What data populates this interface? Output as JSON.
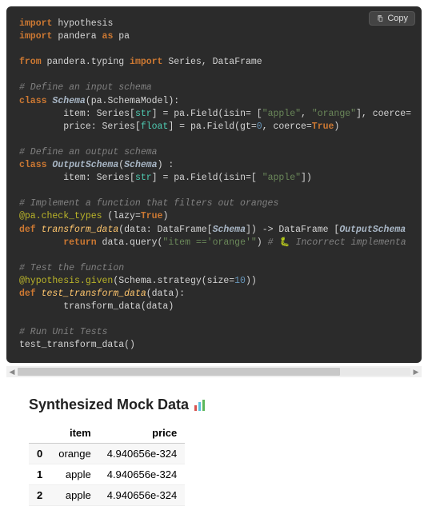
{
  "copy_label": "Copy",
  "code": {
    "l01_import": "import",
    "l01_hypothesis": "hypothesis",
    "l02_import": "import",
    "l02_pandera": "pandera",
    "l02_as": "as",
    "l02_pa": "pa",
    "l04_from": "from",
    "l04_mod": "pandera.typing",
    "l04_import": "import",
    "l04_items": "Series, DataFrame",
    "c1": "# Define an input schema",
    "l06_class": "class",
    "l06_name": "Schema",
    "l06_base": "(pa.SchemaModel):",
    "l07": "        item: Series[",
    "l07_type": "str",
    "l07_b": "] = pa.Field(isin= [",
    "l07_s1": "\"apple\"",
    "l07_c": ", ",
    "l07_s2": "\"orange\"",
    "l07_d": "], coerce=",
    "l08": "        price: Series[",
    "l08_type": "float",
    "l08_b": "] = pa.Field(gt=",
    "l08_n": "0",
    "l08_c": ", coerce=",
    "l08_bool": "True",
    "l08_d": ")",
    "c2": "# Define an output schema",
    "l10_class": "class",
    "l10_name": "OutputSchema",
    "l10_base": "(",
    "l10_base2": "Schema",
    "l10_base3": ") :",
    "l11": "        item: Series[",
    "l11_type": "str",
    "l11_b": "] = pa.Field(isin=[ ",
    "l11_s": "\"apple\"",
    "l11_c": "])",
    "c3": "# Implement a function that filters out oranges",
    "l13_dec": "@pa.check_types",
    "l13_args": " (lazy=",
    "l13_bool": "True",
    "l13_end": ")",
    "l14_def": "def",
    "l14_name": "transform_data",
    "l14_open": "(data: DataFrame[",
    "l14_t1": "Schema",
    "l14_mid": "]) -> DataFrame [",
    "l14_t2": "OutputSchema",
    "l15_ret": "return",
    "l15_body": " data.query(",
    "l15_str": "\"item =='orange'\"",
    "l15_close": ") ",
    "l15_comment": "# 🐛 Incorrect implementa",
    "c4": "# Test the function",
    "l17_dec": "@hypothesis.given",
    "l17_open": "(Schema.strategy(size=",
    "l17_n": "10",
    "l17_close": "))",
    "l18_def": "def",
    "l18_name": "test_transform_data",
    "l18_args": "(data):",
    "l19": "        transform_data(data)",
    "c5": "# Run Unit Tests",
    "l21": "test_transform_data()"
  },
  "heading": "Synthesized Mock Data",
  "chart_icon_name": "bar-chart-icon",
  "table": {
    "headers": {
      "blank": "",
      "item": "item",
      "price": "price"
    },
    "rows": [
      {
        "idx": "0",
        "item": "orange",
        "price": "4.940656e-324"
      },
      {
        "idx": "1",
        "item": "apple",
        "price": "4.940656e-324"
      },
      {
        "idx": "2",
        "item": "apple",
        "price": "4.940656e-324"
      }
    ]
  }
}
